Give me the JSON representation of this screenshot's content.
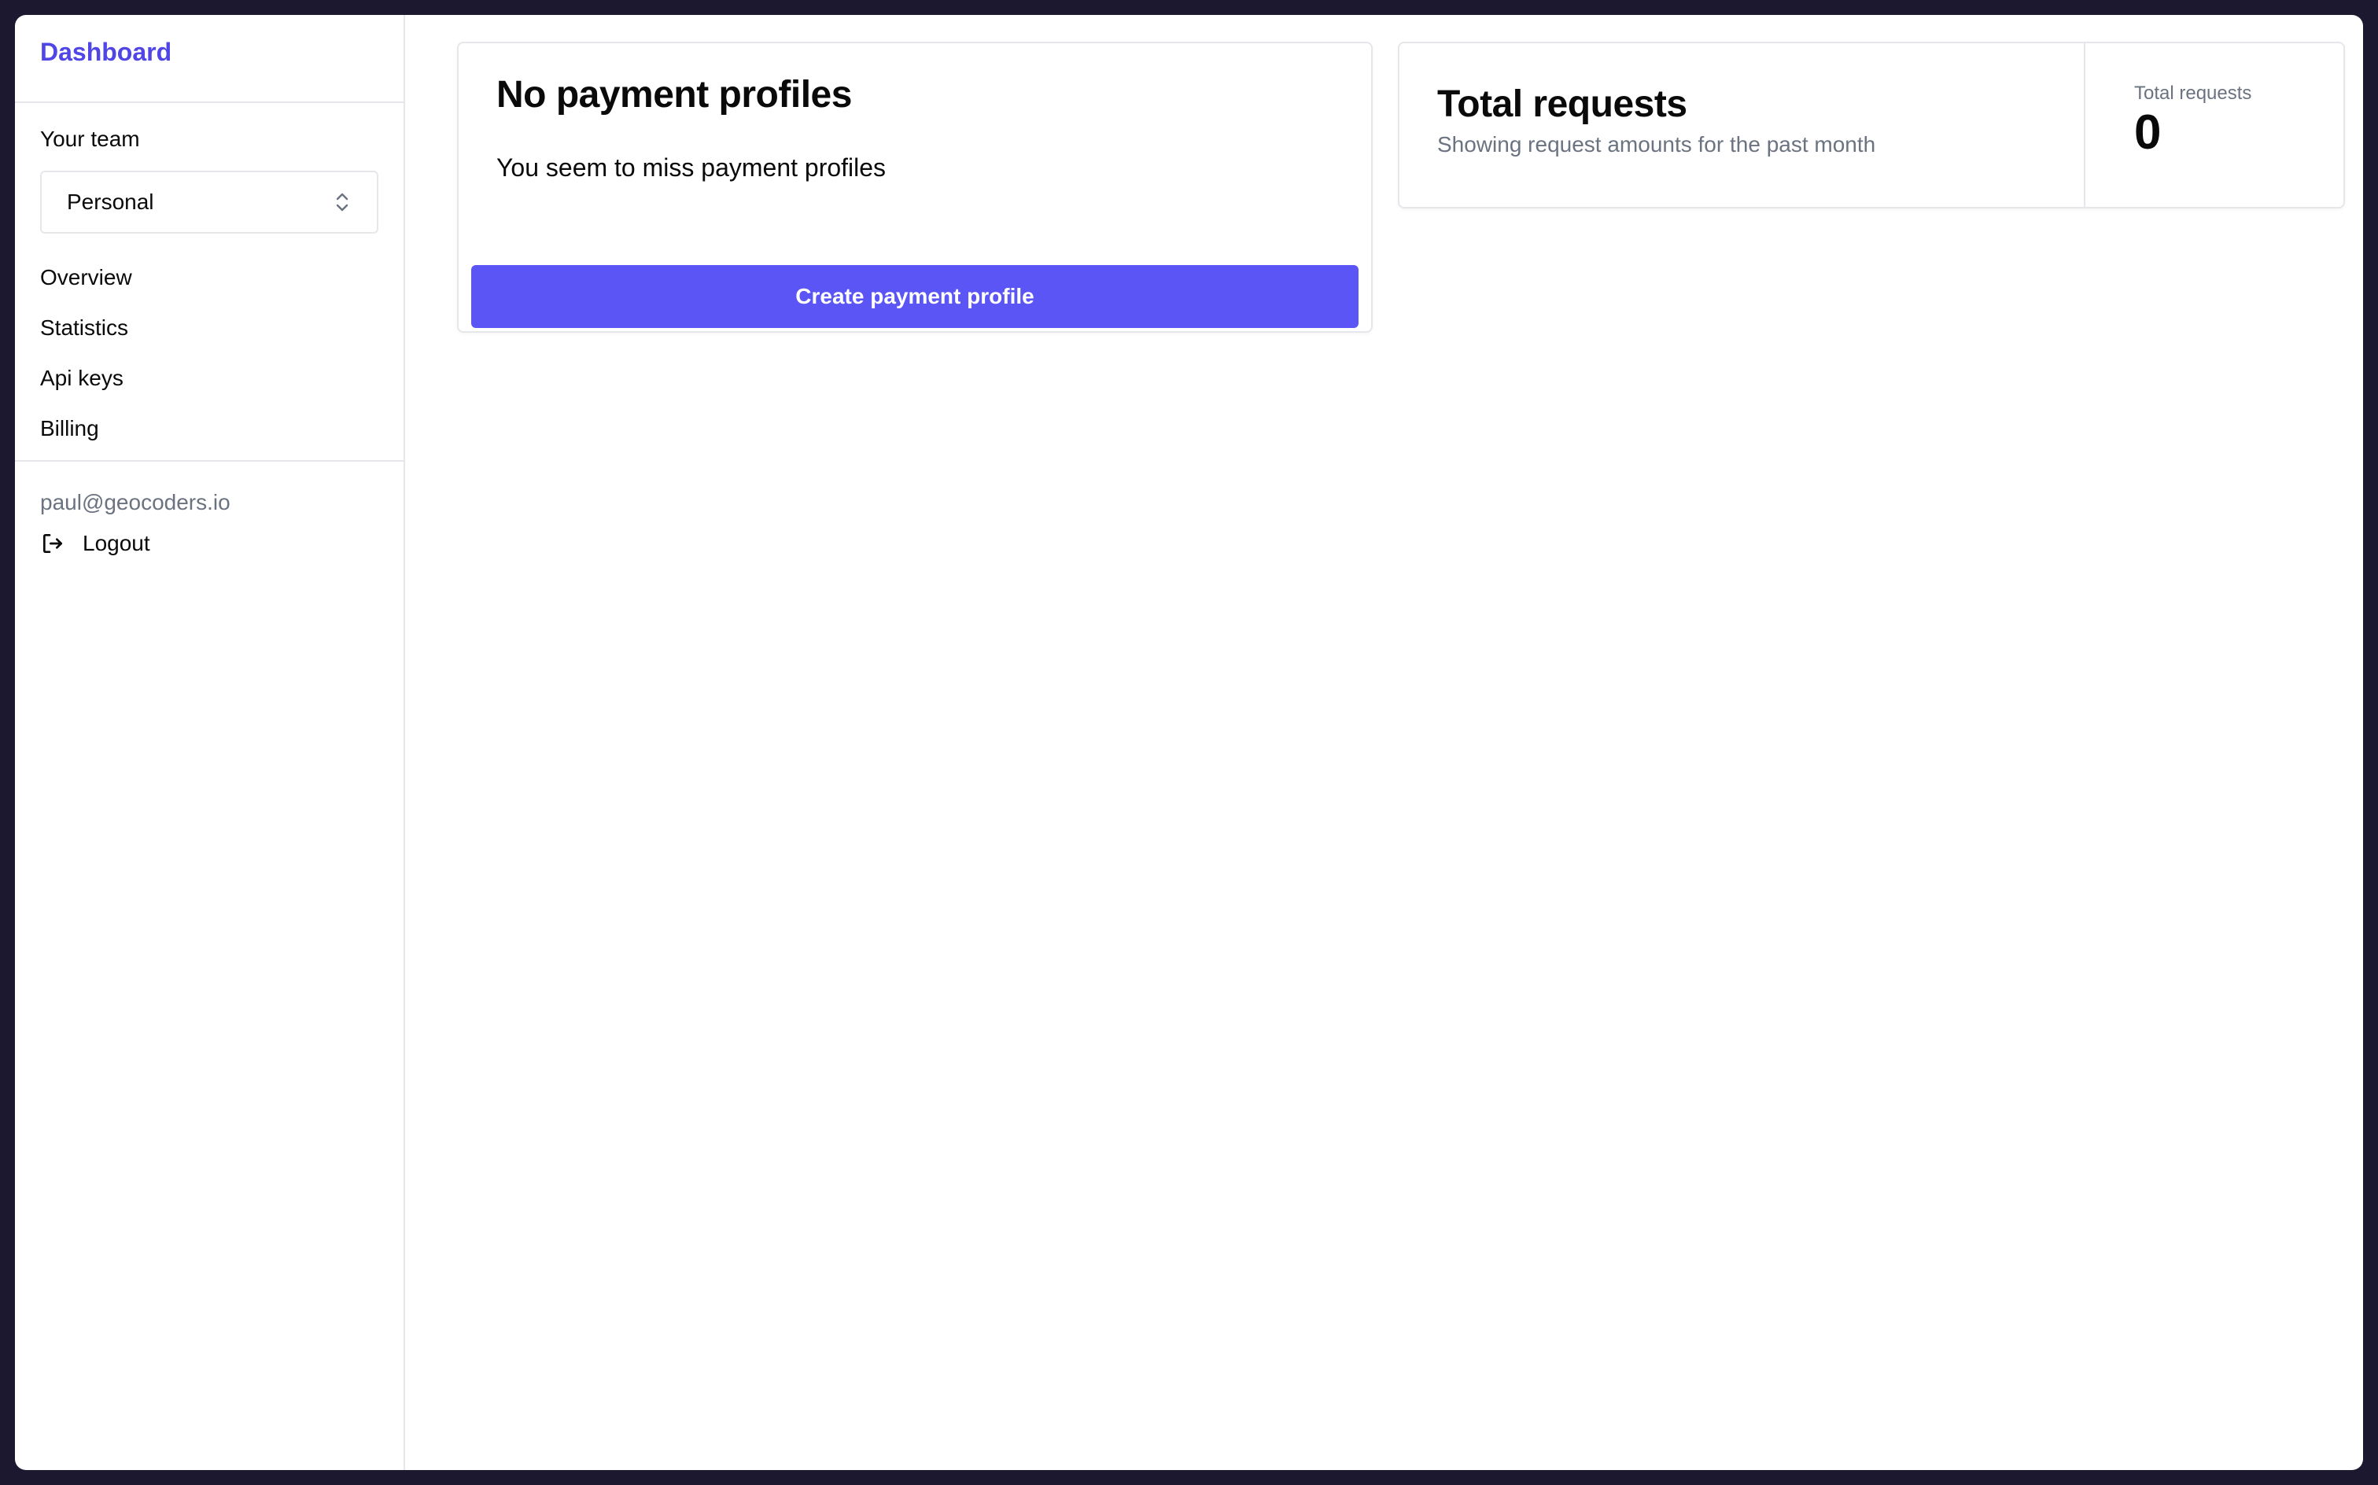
{
  "sidebar": {
    "brand": "Dashboard",
    "team_label": "Your team",
    "team_select": {
      "value": "Personal",
      "icon": "chevron-up-down-icon"
    },
    "nav": [
      {
        "label": "Overview"
      },
      {
        "label": "Statistics"
      },
      {
        "label": "Api keys"
      },
      {
        "label": "Billing"
      }
    ],
    "user_email": "paul@geocoders.io",
    "logout": {
      "label": "Logout",
      "icon": "logout-icon"
    }
  },
  "payment_card": {
    "title": "No payment profiles",
    "message": "You seem to miss payment profiles",
    "button_label": "Create payment profile"
  },
  "requests_card": {
    "title": "Total requests",
    "subtitle": "Showing request amounts for the past month",
    "stat_label": "Total requests",
    "stat_value": "0"
  },
  "colors": {
    "accent": "#5b55f6",
    "brand": "#4f46e5",
    "muted_text": "#6b7280",
    "border": "#e5e7eb"
  }
}
